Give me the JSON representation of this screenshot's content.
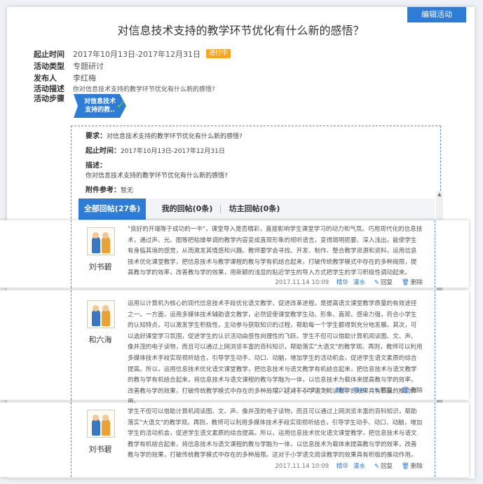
{
  "header": {
    "corner_text": "",
    "edit_button": "编辑活动",
    "title": "对信息技术支持的教学环节优化有什么新的感悟？"
  },
  "meta": {
    "time_label": "起止时间",
    "time_value": "2017年10月13日-2017年12月31日",
    "status": "进行中",
    "type_label": "活动类型",
    "type_value": "专题研讨",
    "publisher_label": "发布人",
    "publisher_value": "李红梅",
    "desc_label": "活动描述",
    "desc_value": "你对信息技术支持的教学环节优化有什么新的感悟?",
    "steps_label": "活动步骤"
  },
  "step": {
    "line1": "对信息技术",
    "line2": "支持的教..",
    "check_icon": "check-icon"
  },
  "detail": {
    "req_label": "要求：",
    "req_value": "对信息技术支持的教学环节优化有什么新的感悟?",
    "time_label": "起止时间：",
    "time_value": "2017年10月13日-2017年12月31日",
    "desc_label": "描述：",
    "desc_value": "你对信息技术支持的教学环节优化有什么新的感悟?",
    "attach_label": "附件参考：",
    "attach_value": "暂无"
  },
  "tabs": [
    {
      "label": "全部回帖(27条)"
    },
    {
      "label": "我的回帖(0条)"
    },
    {
      "label": "坊主回帖(0条)"
    }
  ],
  "replies": [
    {
      "name": "刘书碧",
      "text": "\"良好的开端等于成功的一半\"，课堂导入是否精彩，直接影响学生课堂学习的动力和气氛。巧用现代化的信息技术，通过声、光、图等把枯燥单调的教学内容变成直观形象的视听语言，变得简明扼要、深入浅出，能使学生有身临其境的感觉，从而激发其情感和兴趣。教师要学会寻找、开发、制作、整合教学资源和资料，运用信息技术优化课堂教学，把信息技术与教学课程的教与学有机结合起来，打破传统教学模式中存在的多种局限，提高教与学的效率，改善教与学的效果，用新颖的浅显的贴近学生的导入方式把学生的学习积极性调动起来。",
      "time": "2017.11.14 10:09",
      "tag1": "精华",
      "tag2": "灌水",
      "reply": "回复",
      "delete": "删除"
    },
    {
      "name": "和六海",
      "text": "运用以计算机为核心的现代信息技术手段优化语文教学，促进改革进程，是提高语文课堂教学质量的有效途径之一。一方面，运用多媒体技术辅助语文教学，必然促使课堂教学生动、形象、直观、感染力强，符合小学生的认知特点，可以激发学生积极性，主动参与获取知识的过程，帮助每一个学生都得到充分地发展。其次，可以选好课堂学习氛围，促进学生的认识活动由感性向理性的飞跃。学生不但可以借助计算机阅读图、文、声、像并茂的电子读物，而且可以通过上网浏览丰富的百科知识，帮助落实\"大语文\"的教学观。再则，教师可以利用多媒体技术手段实现视听结合，引导学生动手、动口、动脑，增加学生的活动机会，促进学生语文素质的综合提高。所以，运用信息技术优化语文课堂教学，把信息技术与语文教学有机结合起来，把信息技术与语文教学的教与学有机结合起来，将信息技术与语文课程的教与学融为一体，以信息技术为载体来提高教与学的效率，改善教与学的效果，打破传统教学模式中存在的多种局限。这对于小学语文阅读教学的效果具有积极的推动作用。",
      "time": "2017.11.22 21:34",
      "tag1": "精华",
      "tag2": "灌水",
      "reply": "回复",
      "delete": "删除"
    },
    {
      "name": "刘书碧",
      "text": "学生不但可以借助计算机阅读图、文、声、像并茂的电子读物，而且可以通过上网浏览丰富的百科知识，帮助落实\"大语文\"的教学观。再则，教师可以利用多媒体技术手段实现视听结合，引导学生动手、动口、动脑，增加学生的活动机会，促进学生语文素质的综合提高。所以，运用信息技术优化语文课堂教学，把信息技术与语文教学有机结合起来，将信息技术与语文课程的教与学融为一体，以信息技术为载体来提高教与学的效率，改善教与学的效果，打破传统教学模式中存在的多种局限。这对于小学语文阅读教学的效果具有积极的推动作用。",
      "time": "2017.11.14 10:09",
      "tag1": "精华",
      "tag2": "灌水",
      "reply": "回复",
      "delete": "删除"
    }
  ]
}
